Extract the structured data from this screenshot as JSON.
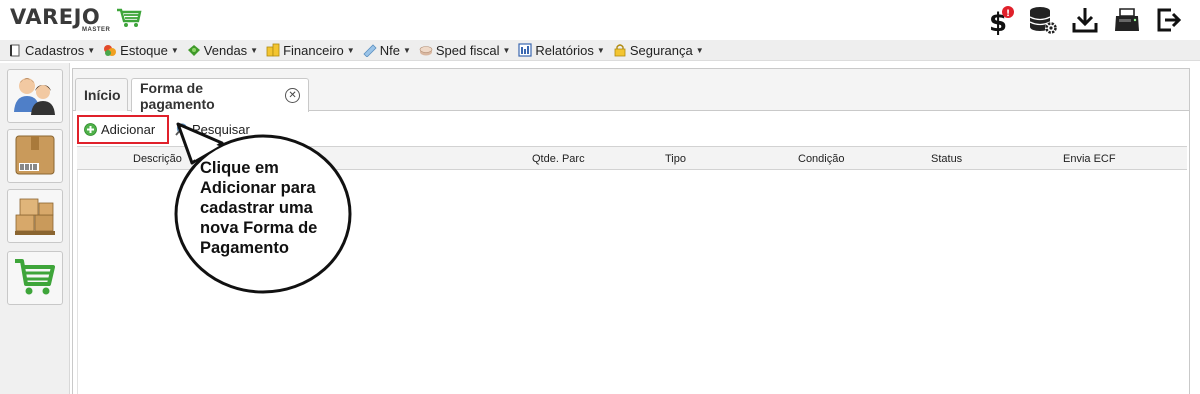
{
  "app": {
    "logo_text": "VAREJO",
    "logo_subtext": "MASTER"
  },
  "header_icons": [
    {
      "name": "dollar-alert-icon",
      "badge": "!"
    },
    {
      "name": "database-settings-icon"
    },
    {
      "name": "download-icon"
    },
    {
      "name": "printer-icon"
    },
    {
      "name": "logout-icon"
    }
  ],
  "menu": [
    {
      "label": "Cadastros",
      "icon": "book-icon"
    },
    {
      "label": "Estoque",
      "icon": "boxes-icon"
    },
    {
      "label": "Vendas",
      "icon": "cart-icon"
    },
    {
      "label": "Financeiro",
      "icon": "coins-icon"
    },
    {
      "label": "Nfe",
      "icon": "nfe-icon"
    },
    {
      "label": "Sped fiscal",
      "icon": "sped-icon"
    },
    {
      "label": "Relatórios",
      "icon": "report-icon"
    },
    {
      "label": "Segurança",
      "icon": "lock-icon"
    }
  ],
  "quick_buttons": [
    {
      "name": "users-icon"
    },
    {
      "name": "product-box-icon"
    },
    {
      "name": "stock-boxes-icon"
    },
    {
      "name": "shopping-cart-icon"
    }
  ],
  "tabs": {
    "inicio": "Início",
    "current": "Forma de pagamento",
    "close": "✕"
  },
  "toolbar": {
    "add_label": "Adicionar",
    "search_label": "Pesquisar"
  },
  "grid": {
    "columns": [
      "Descrição",
      "Qtde. Parc",
      "Tipo",
      "Condição",
      "Status",
      "Envia ECF"
    ],
    "rows": []
  },
  "callout": {
    "text": "Clique em Adicionar para cadastrar uma nova Forma de Pagamento"
  },
  "colors": {
    "highlight": "#e0202a",
    "brand_green": "#3ea53a"
  }
}
